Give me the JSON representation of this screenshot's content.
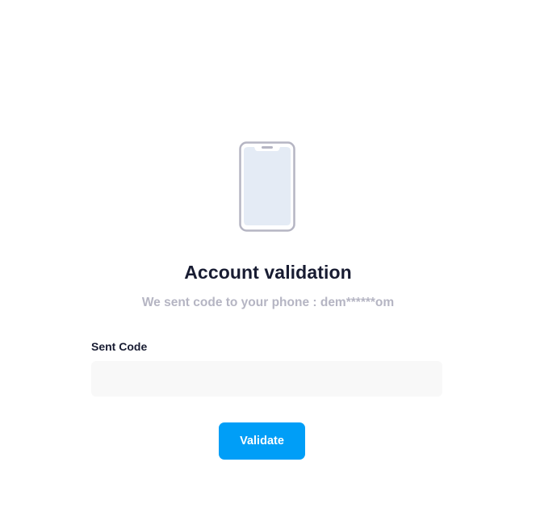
{
  "illustration": {
    "icon": "smartphone-icon",
    "frame_color": "#b5b5c3",
    "screen_color": "#e4ebf5"
  },
  "header": {
    "title": "Account validation",
    "subtitle": "We sent code to your phone : dem******om"
  },
  "form": {
    "code_label": "Sent Code",
    "code_value": "",
    "code_placeholder": ""
  },
  "actions": {
    "validate_label": "Validate",
    "accent_color": "#009ef7"
  }
}
